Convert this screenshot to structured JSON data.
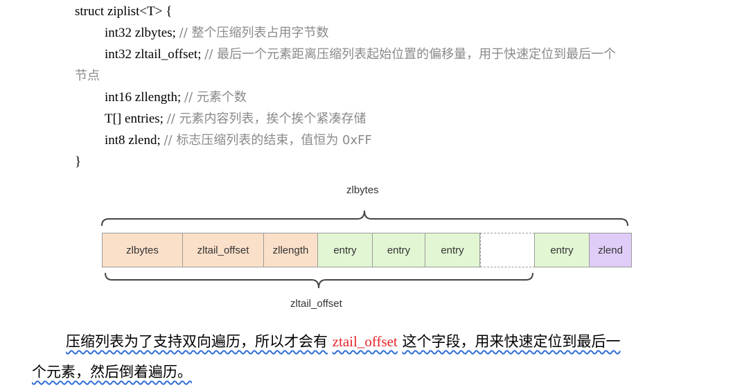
{
  "code": {
    "struct_open": "struct ziplist<T> {",
    "fields": [
      {
        "decl": "int32 zlbytes;",
        "comment": "// 整个压缩列表占用字节数"
      },
      {
        "decl": "int32 zltail_offset;",
        "comment": "// 最后一个元素距离压缩列表起始位置的偏移量，用于快速定位到最后一个",
        "comment_cont": "节点"
      },
      {
        "decl": "int16 zllength;",
        "comment": "// 元素个数"
      },
      {
        "decl": "T[] entries;",
        "comment": "// 元素内容列表，挨个挨个紧凑存储"
      },
      {
        "decl": "int8 zlend;",
        "comment": "// 标志压缩列表的结束，值恒为 0xFF"
      }
    ],
    "struct_close": "}"
  },
  "diagram": {
    "top_label": "zlbytes",
    "bottom_label": "zltail_offset",
    "cells": [
      "zlbytes",
      "zltail_offset",
      "zllength",
      "entry",
      "entry",
      "entry",
      "",
      "entry",
      "zlend"
    ],
    "colors": {
      "header": "#fbe0c9",
      "entry": "#e3f6d4",
      "end": "#e0cdf7",
      "border": "#9a9a9a"
    }
  },
  "paragraph": {
    "line1_before": "压缩列表为了支持双向遍历，所以才会有",
    "highlight": "ztail_offset",
    "line1_after": "这个字段，用来快速定位到最后一",
    "line2": "个元素，然后倒着遍历。",
    "highlight_color": "#e8242a"
  }
}
